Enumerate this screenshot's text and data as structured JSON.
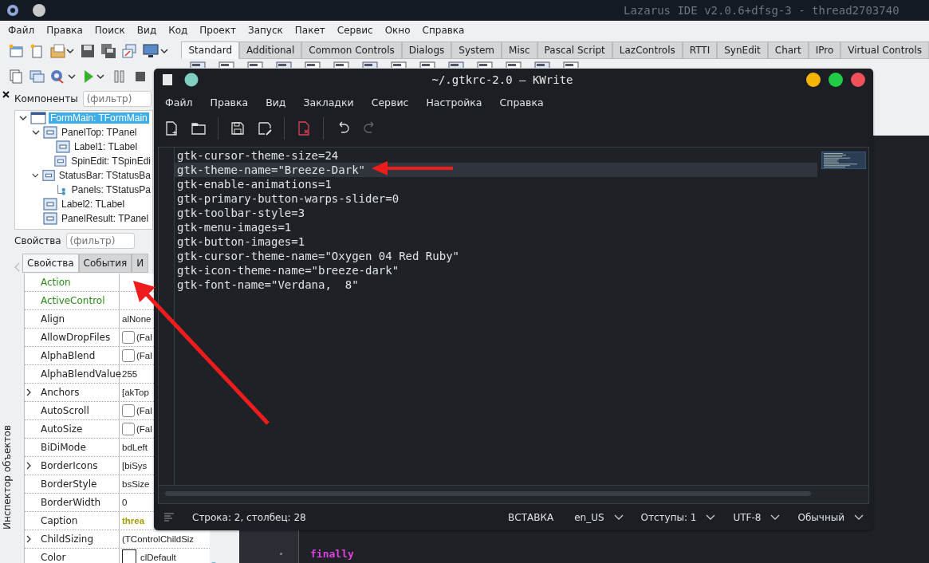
{
  "ide": {
    "title": "Lazarus IDE v2.0.6+dfsg-3 - thread2703740",
    "menu": [
      "Файл",
      "Правка",
      "Поиск",
      "Вид",
      "Код",
      "Проект",
      "Запуск",
      "Пакет",
      "Сервис",
      "Окно",
      "Справка"
    ],
    "palette_tabs": [
      {
        "label": "Standard",
        "selected": true
      },
      {
        "label": "Additional",
        "selected": false
      },
      {
        "label": "Common Controls",
        "selected": false
      },
      {
        "label": "Dialogs",
        "selected": false
      },
      {
        "label": "System",
        "selected": false
      },
      {
        "label": "Misc",
        "selected": false
      },
      {
        "label": "Pascal Script",
        "selected": false
      },
      {
        "label": "LazControls",
        "selected": false
      },
      {
        "label": "RTTI",
        "selected": false
      },
      {
        "label": "SynEdit",
        "selected": false
      },
      {
        "label": "Chart",
        "selected": false
      },
      {
        "label": "IPro",
        "selected": false
      },
      {
        "label": "Virtual Controls",
        "selected": false
      }
    ],
    "inspector": {
      "components_label": "Компоненты",
      "components_filter": {
        "placeholder": "(фильтр)"
      },
      "tree": [
        {
          "label": "FormMain: TFormMain",
          "kind": "form",
          "selected": true,
          "expanded": true,
          "children": [
            {
              "label": "PanelTop: TPanel",
              "kind": "control",
              "selected": false,
              "expanded": true,
              "children": [
                {
                  "label": "Label1: TLabel",
                  "kind": "control",
                  "selected": false
                },
                {
                  "label": "SpinEdit: TSpinEdi",
                  "kind": "control",
                  "selected": false
                }
              ]
            },
            {
              "label": "StatusBar: TStatusBa",
              "kind": "control",
              "selected": false,
              "expanded": true,
              "children": [
                {
                  "label": "Panels: TStatusPa",
                  "kind": "collection",
                  "selected": false
                }
              ]
            },
            {
              "label": "Label2: TLabel",
              "kind": "control",
              "selected": false
            },
            {
              "label": "PanelResult: TPanel",
              "kind": "control",
              "selected": false
            }
          ]
        }
      ],
      "properties_label": "Свойства",
      "properties_filter": {
        "placeholder": "(фильтр)"
      },
      "tabs": [
        {
          "label": "Свойства",
          "selected": true
        },
        {
          "label": "События",
          "selected": false
        },
        {
          "label": "И",
          "selected": false
        }
      ],
      "properties": [
        {
          "name": "Action",
          "highlighted": true,
          "expandable": false,
          "kind": "plain"
        },
        {
          "name": "ActiveControl",
          "highlighted": true,
          "expandable": false,
          "kind": "plain"
        },
        {
          "name": "Align",
          "highlighted": false,
          "expandable": false,
          "kind": "plain",
          "value": "alNone"
        },
        {
          "name": "AllowDropFiles",
          "highlighted": false,
          "expandable": false,
          "kind": "check",
          "checked": false,
          "value": "(Fal"
        },
        {
          "name": "AlphaBlend",
          "highlighted": false,
          "expandable": false,
          "kind": "check",
          "checked": false,
          "value": "(Fal"
        },
        {
          "name": "AlphaBlendValue",
          "highlighted": false,
          "expandable": false,
          "kind": "plain",
          "value": "255"
        },
        {
          "name": "Anchors",
          "highlighted": false,
          "expandable": true,
          "kind": "plain",
          "value": "[akTop"
        },
        {
          "name": "AutoScroll",
          "highlighted": false,
          "expandable": false,
          "kind": "check",
          "checked": false,
          "value": "(Fal"
        },
        {
          "name": "AutoSize",
          "highlighted": false,
          "expandable": false,
          "kind": "check",
          "checked": false,
          "value": "(Fal"
        },
        {
          "name": "BiDiMode",
          "highlighted": false,
          "expandable": false,
          "kind": "plain",
          "value": "bdLeft"
        },
        {
          "name": "BorderIcons",
          "highlighted": false,
          "expandable": true,
          "kind": "plain",
          "value": "[biSys"
        },
        {
          "name": "BorderStyle",
          "highlighted": false,
          "expandable": false,
          "kind": "plain",
          "value": "bsSize"
        },
        {
          "name": "BorderWidth",
          "highlighted": false,
          "expandable": false,
          "kind": "plain",
          "value": "0"
        },
        {
          "name": "Caption",
          "highlighted": false,
          "expandable": false,
          "kind": "caption",
          "value": "threa"
        },
        {
          "name": "ChildSizing",
          "highlighted": false,
          "expandable": true,
          "kind": "plain",
          "value": "(TControlChildSiz"
        },
        {
          "name": "Color",
          "highlighted": false,
          "expandable": false,
          "kind": "color",
          "value": "clDefault"
        }
      ],
      "side_label": "Инспектор объектов"
    },
    "editor": {
      "lines": [
        {
          "text": "finally",
          "kind": "keyword"
        }
      ]
    }
  },
  "kwrite": {
    "title": "~/.gtkrc-2.0 — KWrite",
    "menu": [
      "Файл",
      "Правка",
      "Вид",
      "Закладки",
      "Сервис",
      "Настройка",
      "Справка"
    ],
    "lines": [
      {
        "text": "gtk-cursor-theme-size=24",
        "current": false
      },
      {
        "text": "gtk-theme-name=\"Breeze-Dark\"",
        "current": true
      },
      {
        "text": "gtk-enable-animations=1",
        "current": false
      },
      {
        "text": "gtk-primary-button-warps-slider=0",
        "current": false
      },
      {
        "text": "gtk-toolbar-style=3",
        "current": false
      },
      {
        "text": "gtk-menu-images=1",
        "current": false
      },
      {
        "text": "gtk-button-images=1",
        "current": false
      },
      {
        "text": "gtk-cursor-theme-name=\"Oxygen 04 Red Ruby\"",
        "current": false
      },
      {
        "text": "gtk-icon-theme-name=\"breeze-dark\"",
        "current": false
      },
      {
        "text": "gtk-font-name=\"Verdana,  8\"",
        "current": false
      }
    ],
    "status": {
      "position": "Строка: 2, столбец: 28",
      "mode": "ВСТАВКА",
      "dropdowns": [
        "en_US",
        "Отступы: 1",
        "UTF-8",
        "Обычный"
      ]
    }
  }
}
